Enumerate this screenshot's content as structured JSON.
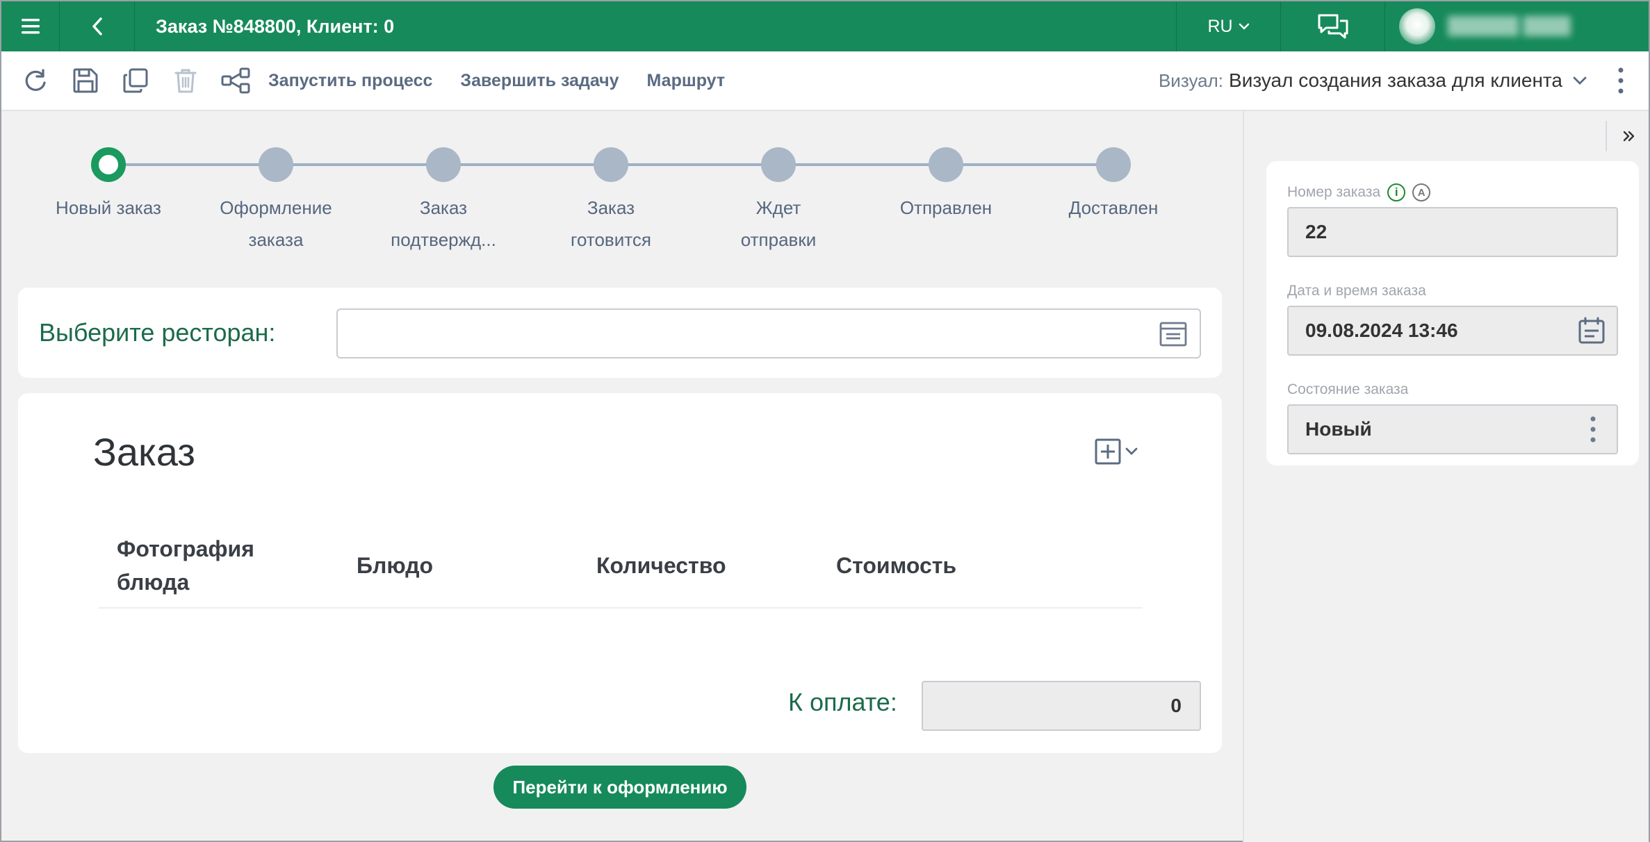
{
  "header": {
    "title": "Заказ №848800, Клиент: 0",
    "language": "RU"
  },
  "toolbar": {
    "actions": [
      {
        "label": "Запустить процесс"
      },
      {
        "label": "Завершить задачу"
      },
      {
        "label": "Маршрут"
      }
    ],
    "visual_label": "Визуал:",
    "visual_value": "Визуал создания заказа для клиента"
  },
  "stepper": {
    "active_index": 0,
    "steps": [
      {
        "label": "Новый заказ"
      },
      {
        "label": "Оформление заказа"
      },
      {
        "label": "Заказ подтвержд..."
      },
      {
        "label": "Заказ готовится"
      },
      {
        "label": "Ждет отправки"
      },
      {
        "label": "Отправлен"
      },
      {
        "label": "Доставлен"
      }
    ]
  },
  "restaurant": {
    "label": "Выберите ресторан:",
    "value": ""
  },
  "order": {
    "title": "Заказ",
    "columns": [
      "Фотография блюда",
      "Блюдо",
      "Количество",
      "Стоимость"
    ],
    "total_label": "К оплате:",
    "total_value": "0"
  },
  "primary_button": "Перейти к оформлению",
  "side_panel": {
    "order_number_label": "Номер заказа",
    "order_number": "22",
    "order_datetime_label": "Дата и время заказа",
    "order_datetime": "09.08.2024 13:46",
    "order_state_label": "Состояние заказа",
    "order_state": "Новый"
  },
  "colors": {
    "brand_green": "#168a5a",
    "step_inactive": "#aab7c7",
    "label_green": "#1c6b4b"
  }
}
